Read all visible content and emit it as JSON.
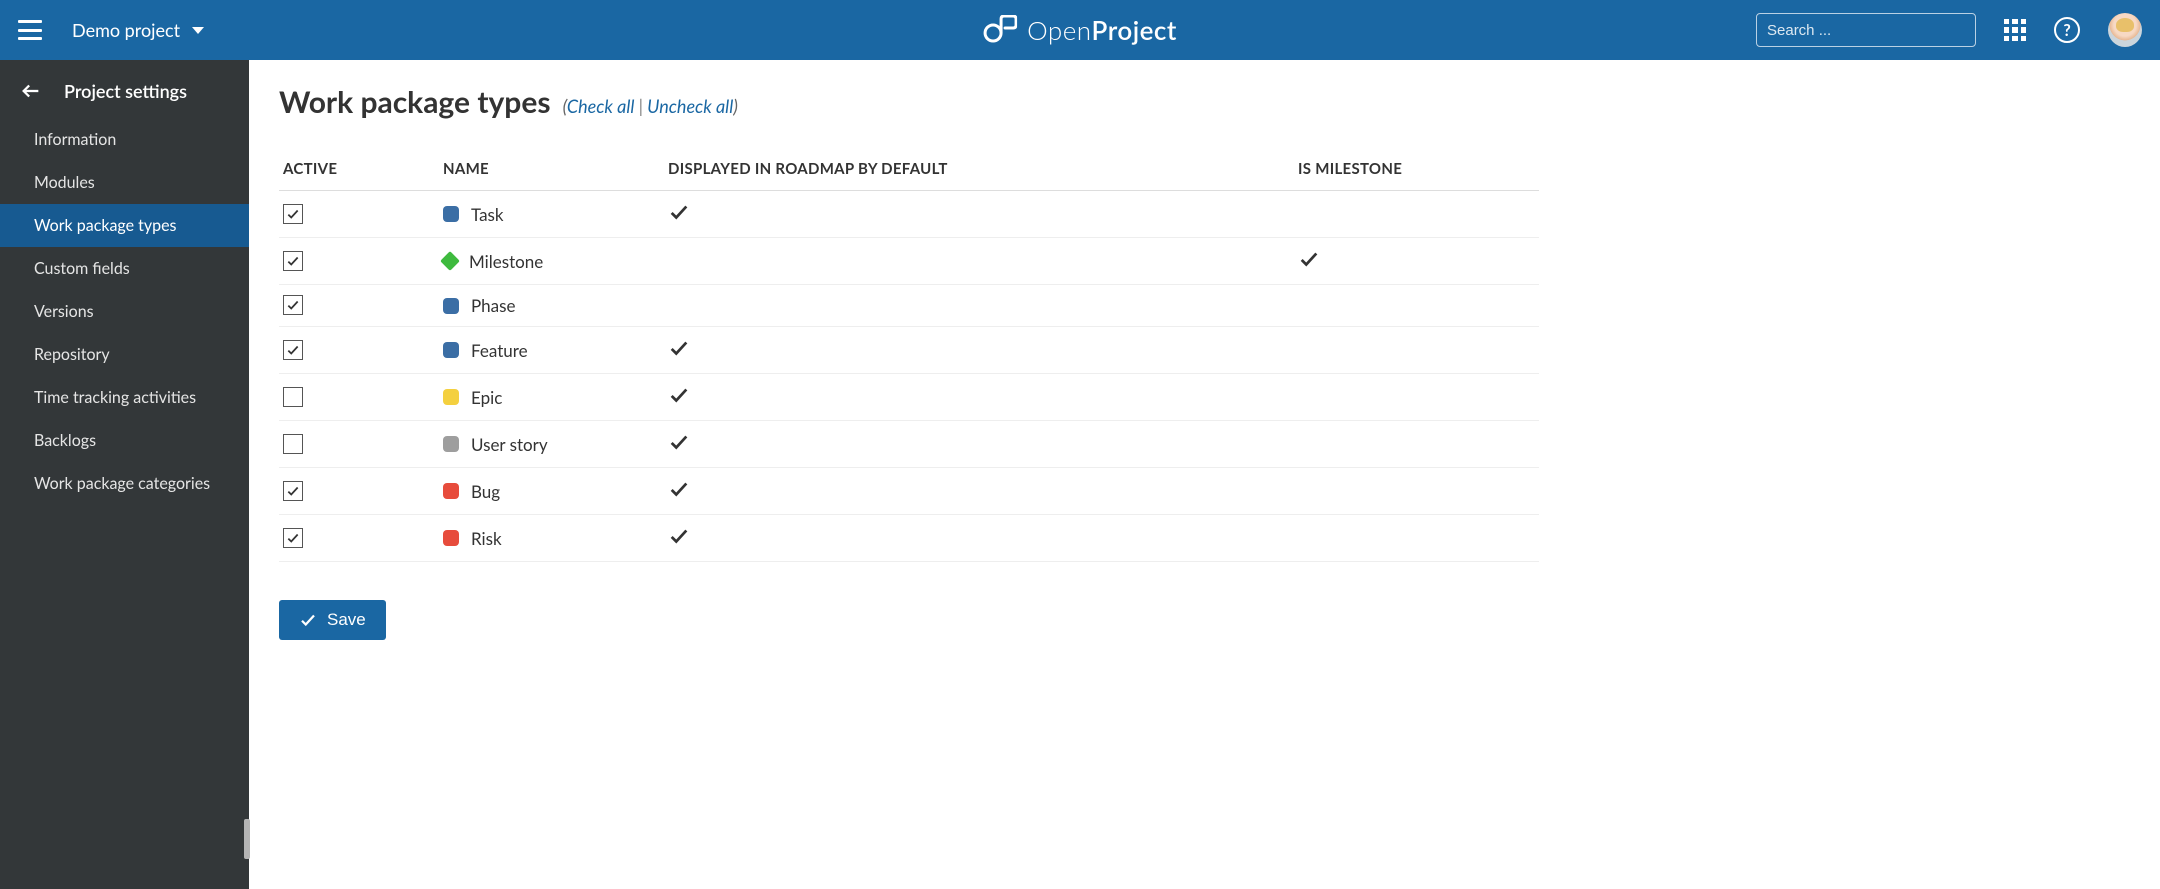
{
  "header": {
    "project_name": "Demo project",
    "brand_light": "Open",
    "brand_bold": "Project",
    "search_placeholder": "Search ..."
  },
  "sidebar": {
    "title": "Project settings",
    "items": [
      {
        "label": "Information",
        "active": false
      },
      {
        "label": "Modules",
        "active": false
      },
      {
        "label": "Work package types",
        "active": true
      },
      {
        "label": "Custom fields",
        "active": false
      },
      {
        "label": "Versions",
        "active": false
      },
      {
        "label": "Repository",
        "active": false
      },
      {
        "label": "Time tracking activities",
        "active": false
      },
      {
        "label": "Backlogs",
        "active": false
      },
      {
        "label": "Work package categories",
        "active": false
      }
    ]
  },
  "main": {
    "title": "Work package types",
    "check_all_label": "Check all",
    "uncheck_all_label": "Uncheck all",
    "columns": {
      "active": "Active",
      "name": "Name",
      "roadmap": "Displayed in roadmap by default",
      "milestone": "Is milestone"
    },
    "rows": [
      {
        "active": true,
        "name": "Task",
        "shape": "square",
        "color": "#3B6EA5",
        "roadmap": true,
        "milestone": false
      },
      {
        "active": true,
        "name": "Milestone",
        "shape": "diamond",
        "color": "#3EBA3E",
        "roadmap": false,
        "milestone": true
      },
      {
        "active": true,
        "name": "Phase",
        "shape": "square",
        "color": "#3B6EA5",
        "roadmap": false,
        "milestone": false
      },
      {
        "active": true,
        "name": "Feature",
        "shape": "square",
        "color": "#3B6EA5",
        "roadmap": true,
        "milestone": false
      },
      {
        "active": false,
        "name": "Epic",
        "shape": "square",
        "color": "#F4D03F",
        "roadmap": true,
        "milestone": false
      },
      {
        "active": false,
        "name": "User story",
        "shape": "square",
        "color": "#9E9E9E",
        "roadmap": true,
        "milestone": false
      },
      {
        "active": true,
        "name": "Bug",
        "shape": "square",
        "color": "#E74C3C",
        "roadmap": true,
        "milestone": false
      },
      {
        "active": true,
        "name": "Risk",
        "shape": "square",
        "color": "#E74C3C",
        "roadmap": true,
        "milestone": false
      }
    ],
    "save_label": "Save"
  }
}
